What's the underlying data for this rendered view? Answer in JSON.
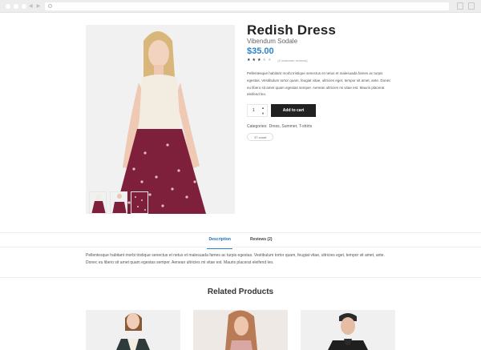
{
  "browser": {
    "colors": {
      "bar": "#ededed",
      "url_bg": "#ffffff"
    }
  },
  "product": {
    "title": "Redish Dress",
    "subtitle": "Vibendum Sodale",
    "price": "$35.00",
    "rating_stars": 3,
    "rating_max": 5,
    "reviews_link": "(2 customer reviews)",
    "description": "Pellentesque habitant morbi tristique senectus et netus et malesuada fames ac turpis egestas. Vestibulum tortor quam, feugiat vitae, ultricies eget, tempor sit amet, ante. Donec eu libero sit amet quam egestas semper. Aenean ultricies mi vitae est. Mauris placerat eleifend leo.",
    "quantity": "1",
    "add_to_cart": "Add to cart",
    "categories_label": "Categories:",
    "categories": "Dress, Summer, T-shirts",
    "tag": "37 count"
  },
  "tabs": {
    "description": "Description",
    "reviews": "Reviews (2)",
    "body": "Pellentesque habitant morbi tristique senectus et netus et malesuada fames ac turpis egestas. Vestibulum tortor quam, feugiat vitae, ultricies eget, tempor sit amet, ante. Donec eu libero sit amet quam egestas semper. Aenean ultricies mi vitae est. Mauris placerat eleifend leo."
  },
  "related": {
    "title": "Related Products"
  },
  "colors": {
    "accent": "#2d82c8",
    "button": "#212121",
    "dress": "#7e1f3b",
    "top": "#f3ece0"
  }
}
